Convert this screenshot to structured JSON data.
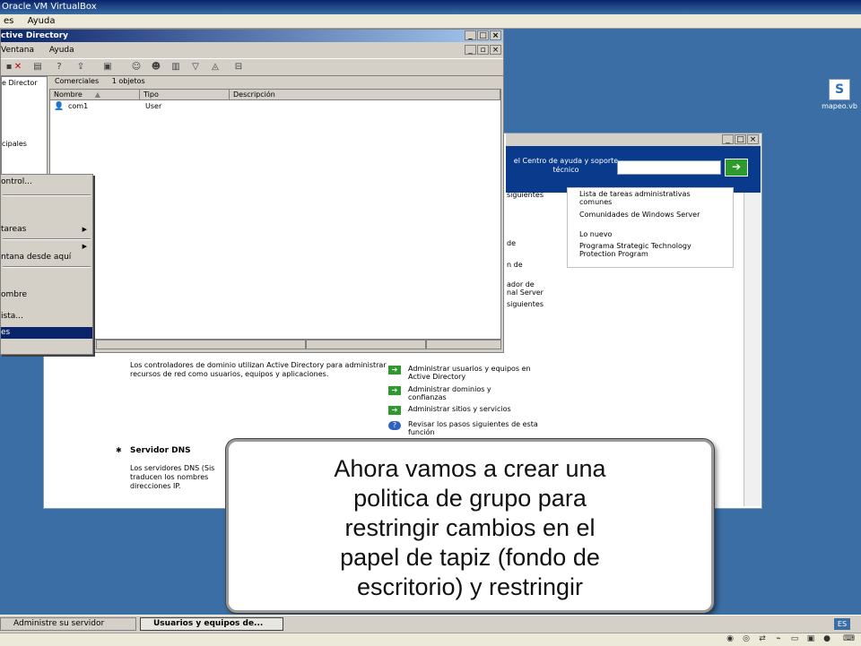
{
  "vbox": {
    "title": "Oracle VM VirtualBox",
    "menu": [
      "es",
      "Ayuda"
    ],
    "status_icons": [
      "disk-icon",
      "cd-icon",
      "network-icon",
      "usb-icon",
      "folder-icon",
      "display-icon",
      "record-icon",
      "keyboard-icon"
    ]
  },
  "desktop_icon": {
    "label": "mapeo.vb"
  },
  "ad_window": {
    "title": "ctive Directory",
    "menu": [
      "Ventana",
      "Ayuda"
    ],
    "tree_items": [
      "e Director",
      "cipales"
    ],
    "content_header": {
      "container": "Comerciales",
      "count": "1 objetos"
    },
    "columns": [
      "Nombre",
      "Tipo",
      "Descripción"
    ],
    "rows": [
      {
        "name": "com1",
        "type": "User",
        "description": ""
      }
    ]
  },
  "context_menu": {
    "items": [
      {
        "label": "ontrol...",
        "submenu": false
      },
      {
        "label": "",
        "submenu": false
      },
      {
        "label": "tareas",
        "submenu": true
      },
      {
        "label": "",
        "submenu": true
      },
      {
        "label": "ntana desde aquí",
        "submenu": false
      },
      {
        "label": "ombre",
        "submenu": false
      },
      {
        "label": "ista...",
        "submenu": false
      },
      {
        "label": "es",
        "submenu": false,
        "selected": true
      }
    ]
  },
  "manage_server": {
    "help_label": "el Centro de ayuda y soporte técnico",
    "help_links": [
      "Lista de tareas administrativas comunes",
      "Comunidades de Windows Server",
      "Lo nuevo",
      "Programa Strategic Technology Protection Program"
    ],
    "fragments": [
      "siguientes",
      "de",
      "n de",
      "ador de",
      "nal Server",
      "siguientes"
    ],
    "dc_description": "Los controladores de dominio utilizan Active Directory para administrar recursos de red como usuarios, equipos y aplicaciones.",
    "dc_tasks": [
      "Administrar usuarios y equipos en Active Directory",
      "Administrar dominios y confianzas",
      "Administrar sitios y servicios",
      "Revisar los pasos siguientes de esta función"
    ],
    "dns_title": "Servidor DNS",
    "dns_description": "Los servidores DNS (Sis traducen los nombres direcciones IP."
  },
  "caption": {
    "text": "Ahora vamos a crear una\npolitica de grupo para\nrestringir cambios en el\npapel de tapiz (fondo de\nescritorio) y restringir"
  },
  "taskbar": {
    "buttons": [
      "Administre su servidor",
      "Usuarios y equipos de..."
    ],
    "language": "ES"
  },
  "colors": {
    "desktop": "#3a6ea5",
    "banner": "#0a3a8c",
    "go_button": "#2e9a2e",
    "menu_highlight": "#0a246a"
  }
}
